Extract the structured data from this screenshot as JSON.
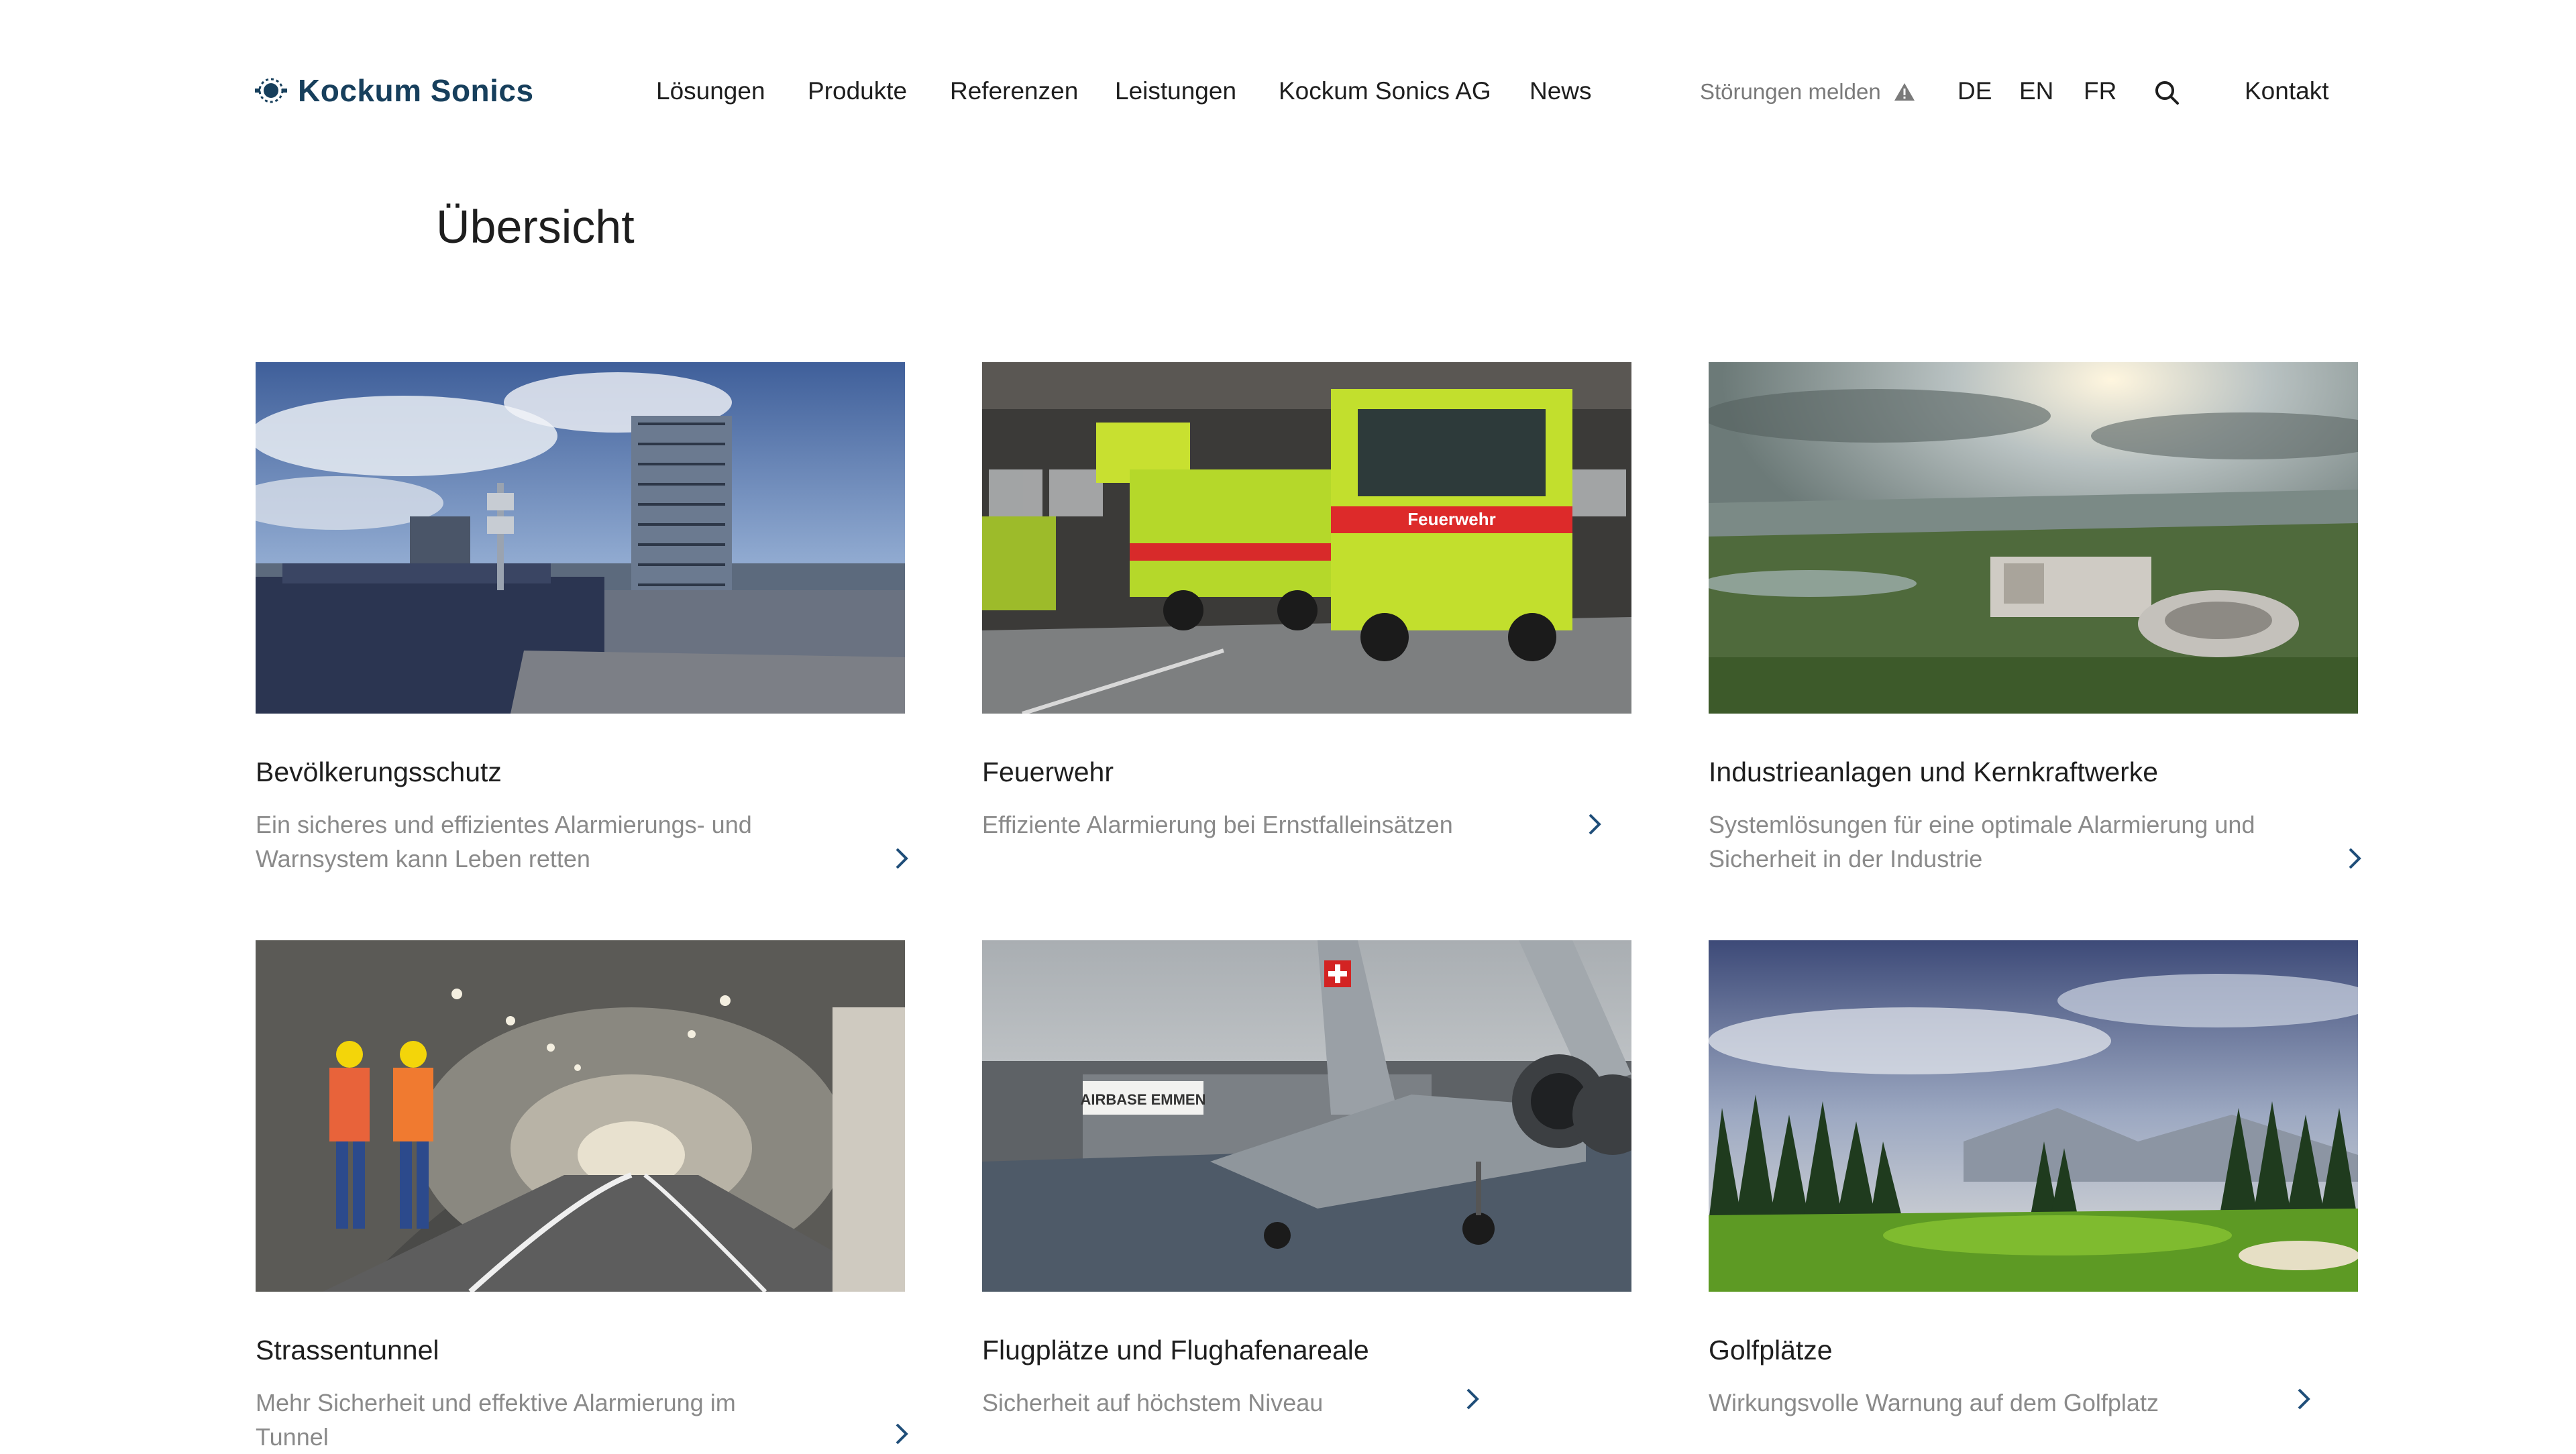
{
  "header": {
    "logo_text": "Kockum Sonics",
    "nav": [
      "Lösungen",
      "Produkte",
      "Referenzen",
      "Leistungen",
      "Kockum Sonics AG",
      "News"
    ],
    "report_label": "Störungen melden",
    "report_icon": "warning-icon",
    "languages": [
      "DE",
      "EN",
      "FR"
    ],
    "search_icon": "search-icon",
    "contact_label": "Kontakt"
  },
  "page": {
    "title": "Übersicht"
  },
  "cards": [
    {
      "title": "Bevölkerungsschutz",
      "description": "Ein sicheres und effizientes Alarmierungs- und Warnsystem kann Leben retten",
      "image": "city-siren-rooftop-photo"
    },
    {
      "title": "Feuerwehr",
      "description": "Effiziente Alarmierung bei Ernstfalleinsätzen",
      "image": "fire-trucks-photo",
      "truck_label": "Feuerwehr"
    },
    {
      "title": "Industrieanlagen und Kernkraftwerke",
      "description": "Systemlösungen für eine optimale Alarmierung und Sicherheit in der Industrie",
      "image": "industrial-plant-aerial-photo"
    },
    {
      "title": "Strassentunnel",
      "description": "Mehr Sicherheit und effektive Alarmierung im Tunnel",
      "image": "road-tunnel-workers-photo"
    },
    {
      "title": "Flugplätze und Flughafenareale",
      "description": "Sicherheit auf höchstem Niveau",
      "image": "fighter-jet-airbase-photo",
      "hangar_label": "AIRBASE EMMEN"
    },
    {
      "title": "Golfplätze",
      "description": "Wirkungsvolle Warnung auf dem Golfplatz",
      "image": "golf-course-photo"
    }
  ],
  "colors": {
    "brand": "#173f5c",
    "text": "#1e1e1e",
    "muted": "#8a8a8a",
    "chevron": "#1f4e79"
  }
}
